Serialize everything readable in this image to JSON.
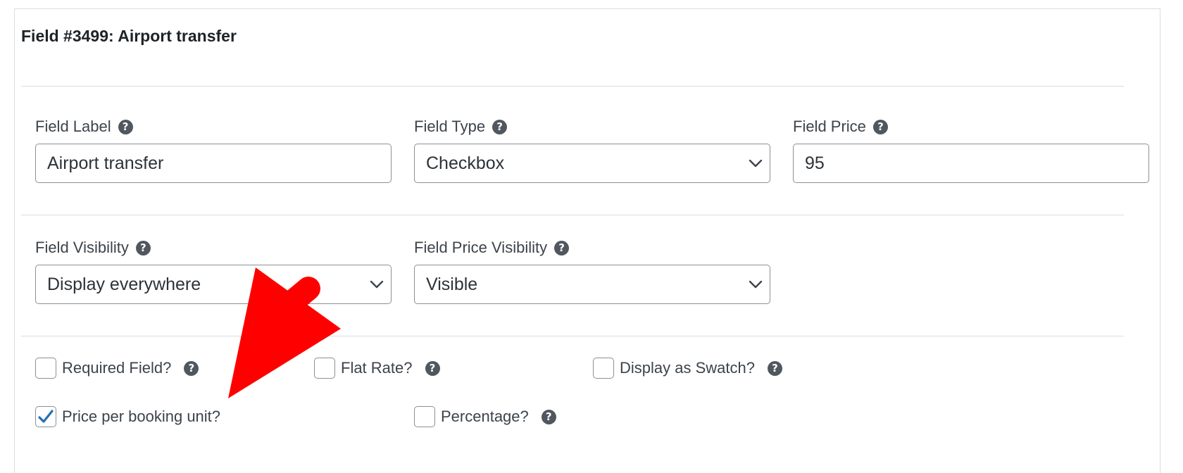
{
  "header": {
    "title": "Field #3499: Airport transfer"
  },
  "row1": {
    "field_label": {
      "label": "Field Label",
      "value": "Airport transfer"
    },
    "field_type": {
      "label": "Field Type",
      "value": "Checkbox"
    },
    "field_price": {
      "label": "Field Price",
      "value": "95"
    }
  },
  "row2": {
    "field_visibility": {
      "label": "Field Visibility",
      "value": "Display everywhere"
    },
    "field_price_visibility": {
      "label": "Field Price Visibility",
      "value": "Visible"
    }
  },
  "options": {
    "required": {
      "label": "Required Field?",
      "checked": false
    },
    "flat_rate": {
      "label": "Flat Rate?",
      "checked": false
    },
    "swatch": {
      "label": "Display as Swatch?",
      "checked": false
    },
    "price_per_unit": {
      "label": "Price per booking unit?",
      "checked": true
    },
    "percentage": {
      "label": "Percentage?",
      "checked": false
    }
  },
  "icons": {
    "help": "question-mark-circle-icon",
    "dropdown": "chevron-down-icon",
    "check": "checkmark-icon",
    "annotation": "red-arrow-annotation"
  },
  "colors": {
    "checkmark": "#2271b1",
    "help_icon": "#50575e",
    "annotation": "#ff0000"
  }
}
